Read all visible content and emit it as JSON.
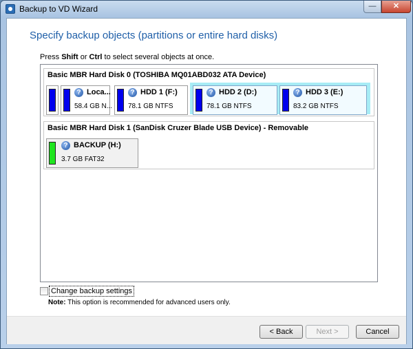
{
  "window": {
    "title": "Backup to VD Wizard",
    "minimize_glyph": "—",
    "close_glyph": "✕"
  },
  "page": {
    "heading": "Specify backup objects (partitions or entire hard disks)",
    "hint": {
      "prefix": "Press ",
      "key1": "Shift",
      "middle": " or ",
      "key2": "Ctrl",
      "suffix": " to select several objects at once."
    }
  },
  "disks": [
    {
      "title": "Basic MBR Hard Disk 0 (TOSHIBA MQ01ABD032 ATA Device)",
      "partitions": [
        {
          "name": "",
          "info": "",
          "bar_color": "#0000ee",
          "selected": false
        },
        {
          "name": "Loca...",
          "info": "58.4 GB N...",
          "bar_color": "#0000ee",
          "selected": false
        },
        {
          "name": "HDD 1 (F:)",
          "info": "78.1 GB NTFS",
          "bar_color": "#0000ee",
          "selected": false
        },
        {
          "name": "HDD 2 (D:)",
          "info": "78.1 GB NTFS",
          "bar_color": "#0000ee",
          "selected": true
        },
        {
          "name": "HDD 3 (E:)",
          "info": "83.2 GB NTFS",
          "bar_color": "#0000ee",
          "selected": true
        }
      ]
    },
    {
      "title": "Basic MBR Hard Disk 1 (SanDisk Cruzer Blade USB Device) - Removable",
      "partitions": [
        {
          "name": "BACKUP (H:)",
          "info": "3.7 GB FAT32",
          "bar_color": "#1fe51f",
          "selected": false
        }
      ]
    }
  ],
  "options": {
    "change_settings_label": "Change backup settings",
    "change_settings_checked": false,
    "note_label": "Note:",
    "note_text": " This option is recommended for advanced users only."
  },
  "buttons": {
    "back": "< Back",
    "next": "Next >",
    "cancel": "Cancel"
  },
  "icons": {
    "partition_status": "question-mark-icon",
    "question_glyph": "?"
  }
}
